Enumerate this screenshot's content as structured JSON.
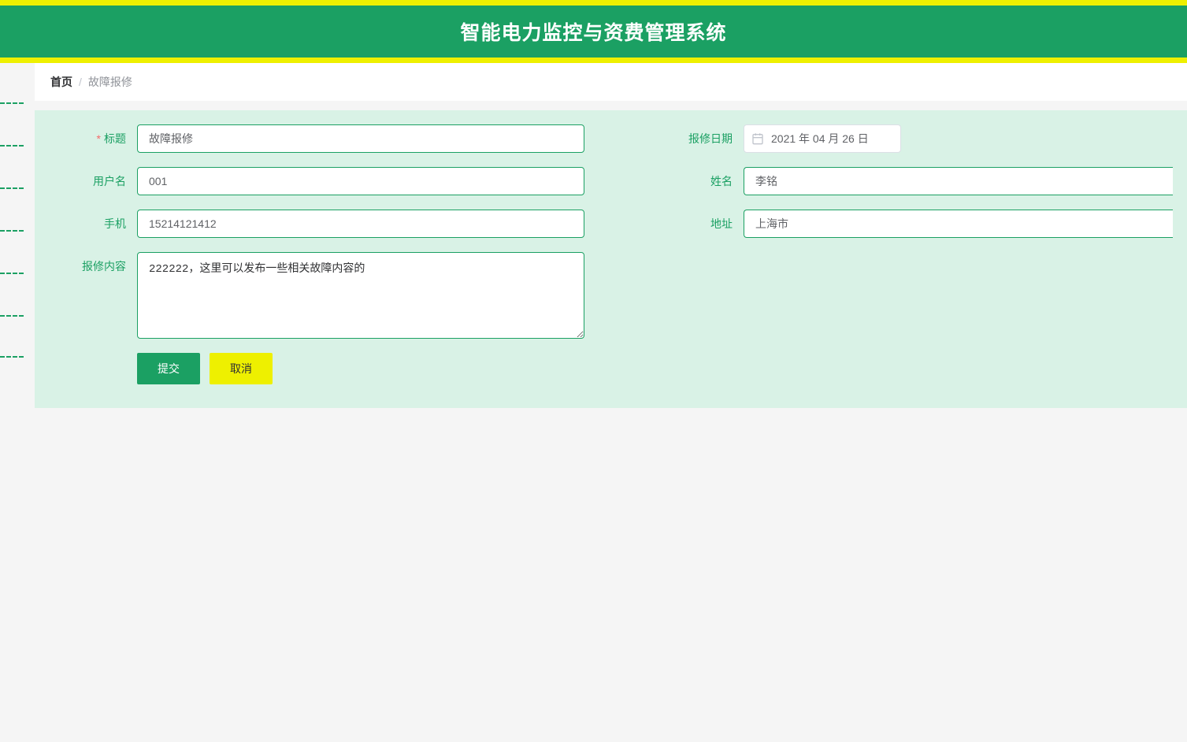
{
  "header": {
    "title": "智能电力监控与资费管理系统"
  },
  "breadcrumb": {
    "home": "首页",
    "separator": "/",
    "current": "故障报修"
  },
  "form": {
    "labels": {
      "title": "标题",
      "date": "报修日期",
      "username": "用户名",
      "name": "姓名",
      "phone": "手机",
      "address": "地址",
      "content": "报修内容"
    },
    "values": {
      "title": "故障报修",
      "date": "2021 年 04 月 26 日",
      "username": "001",
      "name": "李铭",
      "phone": "15214121412",
      "address": "上海市",
      "content": "222222，这里可以发布一些相关故障内容的"
    },
    "buttons": {
      "submit": "提交",
      "cancel": "取消"
    }
  }
}
